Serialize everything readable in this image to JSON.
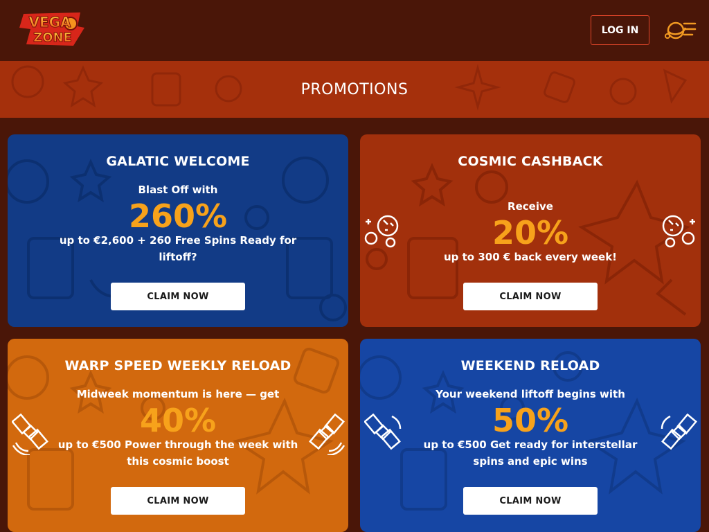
{
  "header": {
    "logo_line1": "VEGA",
    "logo_line2": "ZONE",
    "login_label": "LOG IN",
    "menu_icon": "planet-menu-icon"
  },
  "banner": {
    "title": "PROMOTIONS"
  },
  "promotions": [
    {
      "title": "GALATIC WELCOME",
      "lead": "Blast Off with",
      "highlight": "260%",
      "description": "up to €2,600 + 260 Free Spins Ready for liftoff?",
      "button_label": "CLAIM NOW",
      "background": "#123b86"
    },
    {
      "title": "COSMIC CASHBACK",
      "lead": "Receive",
      "highlight": "20%",
      "description": "up to 300 € back every week!",
      "button_label": "CLAIM NOW",
      "background": "#a2300c",
      "side_icon": "planets-icon"
    },
    {
      "title": "WARP SPEED WEEKLY RELOAD",
      "lead": "Midweek momentum is here — get",
      "highlight": "40%",
      "description": "up to €500 Power through the week with this cosmic boost",
      "button_label": "CLAIM NOW",
      "background": "#d2690e",
      "side_icon": "satellite-icon"
    },
    {
      "title": "WEEKEND RELOAD",
      "lead": "Your weekend liftoff begins with",
      "highlight": "50%",
      "description": "up to €500 Get ready for interstellar spins and epic wins",
      "button_label": "CLAIM NOW",
      "background": "#1646a4",
      "side_icon": "satellite-icon"
    }
  ],
  "colors": {
    "page_bg": "#4a1608",
    "banner_bg": "#a5300c",
    "highlight": "#f7a21b",
    "login_border": "#e2462a"
  }
}
